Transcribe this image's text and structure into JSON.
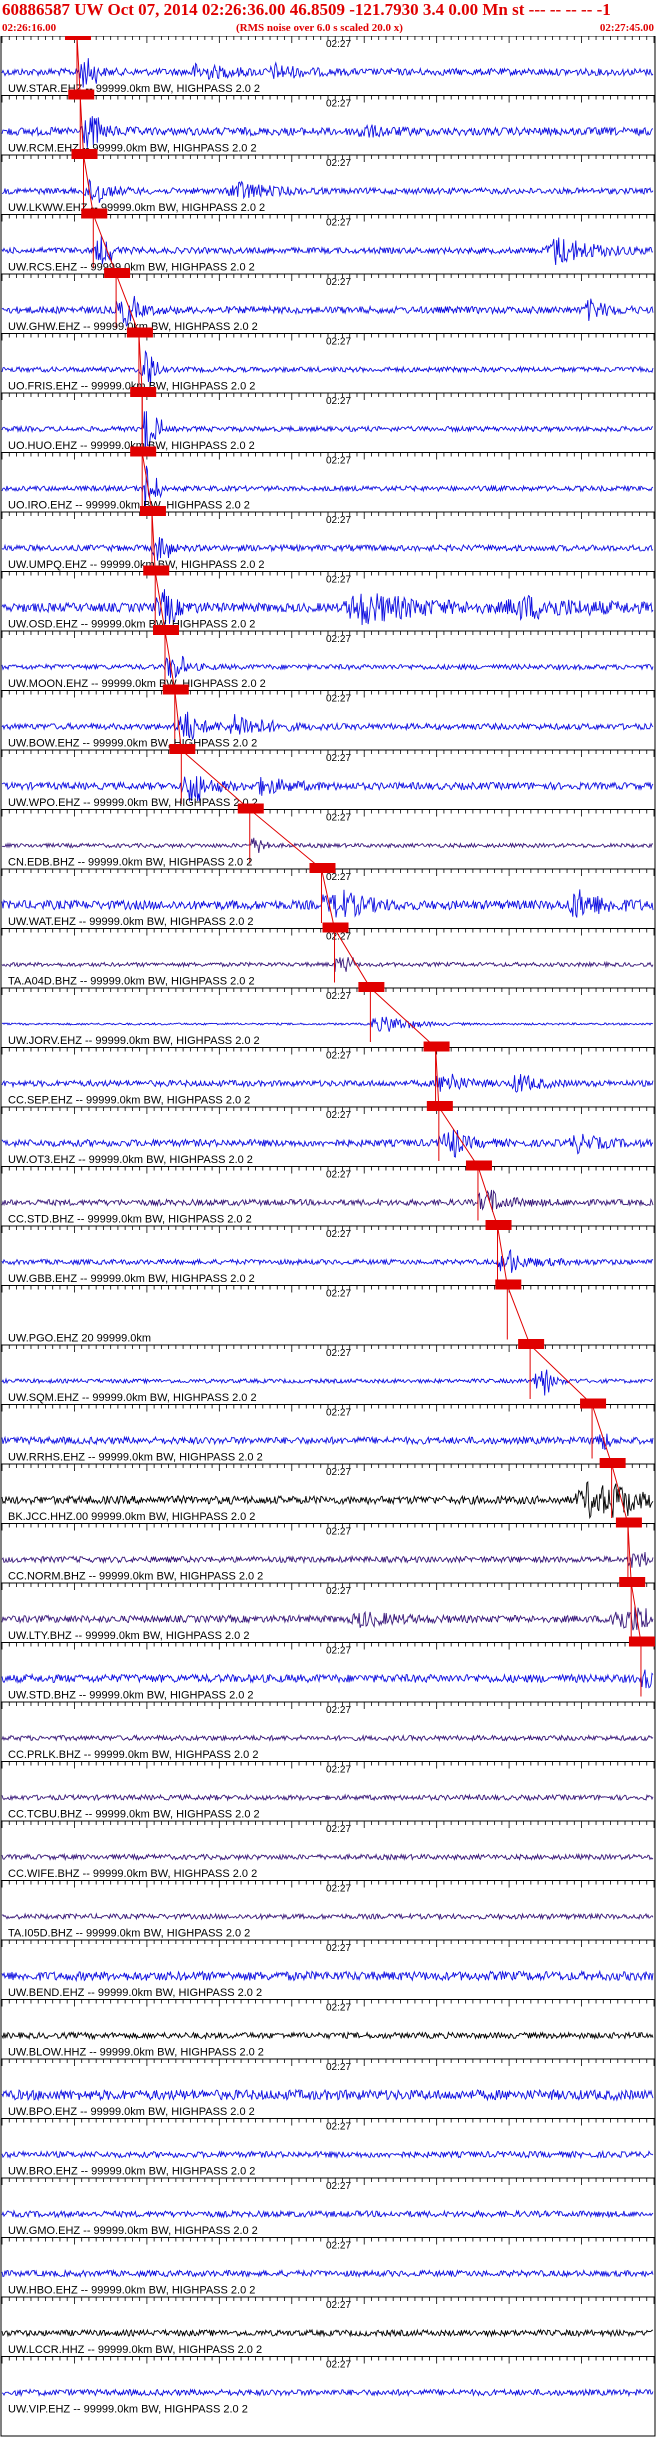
{
  "header": {
    "title": "60886587 UW Oct 07, 2014 02:26:36.00   46.8509 -121.7930  3.4 0.00 Mn st --- -- -- -- -1",
    "start_time": "02:26:16.00",
    "note": "(RMS noise over 6.0 s scaled 20.0 x)",
    "end_time": "02:27:45.00"
  },
  "axis": {
    "mid_tick_label": "02:27"
  },
  "colors": {
    "pick": "#e00000",
    "blue": "#1010e0",
    "purple": "#3a1a7a",
    "black": "#000000"
  },
  "traces": [
    {
      "label": "UW.STAR.EHZ -- 99999.0km BW, HIGHPASS  2.0  2",
      "color": "#1010e0",
      "amp": 0.35,
      "pick": 0.115,
      "bursts": [
        {
          "at": 0.12,
          "w": 0.02,
          "a": 1.0
        },
        {
          "at": 0.3,
          "w": 0.05,
          "a": 0.7
        },
        {
          "at": 0.42,
          "w": 0.04,
          "a": 0.6
        }
      ]
    },
    {
      "label": "UW.RCM.EHZ -- 99999.0km BW, HIGHPASS  2.0  2",
      "color": "#1010e0",
      "amp": 0.4,
      "pick": 0.12,
      "bursts": [
        {
          "at": 0.13,
          "w": 0.03,
          "a": 0.9
        },
        {
          "at": 0.55,
          "w": 0.04,
          "a": 0.5
        }
      ]
    },
    {
      "label": "UW.LKWW.EHZ -- 99999.0km BW, HIGHPASS  2.0  2",
      "color": "#1010e0",
      "amp": 0.3,
      "pick": 0.125,
      "bursts": [
        {
          "at": 0.14,
          "w": 0.03,
          "a": 0.8
        },
        {
          "at": 0.36,
          "w": 0.05,
          "a": 0.9
        }
      ]
    },
    {
      "label": "UW.RCS.EHZ -- 99999.0km BW, HIGHPASS  2.0  2",
      "color": "#1010e0",
      "amp": 0.3,
      "pick": 0.14,
      "bursts": [
        {
          "at": 0.15,
          "w": 0.02,
          "a": 0.7
        },
        {
          "at": 0.85,
          "w": 0.06,
          "a": 1.4
        }
      ]
    },
    {
      "label": "UW.GHW.EHZ -- 99999.0km BW, HIGHPASS  2.0  2",
      "color": "#1010e0",
      "amp": 0.35,
      "pick": 0.175,
      "bursts": [
        {
          "at": 0.19,
          "w": 0.03,
          "a": 0.8
        },
        {
          "at": 0.9,
          "w": 0.03,
          "a": 0.9
        }
      ]
    },
    {
      "label": "UO.FRIS.EHZ -- 99999.0km BW, HIGHPASS  2.0  2",
      "color": "#1010e0",
      "amp": 0.25,
      "pick": 0.21,
      "bursts": [
        {
          "at": 0.22,
          "w": 0.01,
          "a": 2.5
        }
      ]
    },
    {
      "label": "UO.HUO.EHZ -- 99999.0km BW, HIGHPASS  2.0  2",
      "color": "#1010e0",
      "amp": 0.25,
      "pick": 0.215,
      "bursts": [
        {
          "at": 0.22,
          "w": 0.01,
          "a": 2.5
        }
      ]
    },
    {
      "label": "UO.IRO.EHZ -- 99999.0km BW, HIGHPASS  2.0  2",
      "color": "#1010e0",
      "amp": 0.25,
      "pick": 0.215,
      "bursts": [
        {
          "at": 0.22,
          "w": 0.01,
          "a": 2.5
        }
      ]
    },
    {
      "label": "UW.UMPQ.EHZ -- 99999.0km BW, HIGHPASS  2.0  2",
      "color": "#1010e0",
      "amp": 0.3,
      "pick": 0.23,
      "bursts": [
        {
          "at": 0.24,
          "w": 0.02,
          "a": 0.6
        }
      ]
    },
    {
      "label": "UW.OSD.EHZ -- 99999.0km BW, HIGHPASS  2.0  2",
      "color": "#1010e0",
      "amp": 0.45,
      "pick": 0.235,
      "bursts": [
        {
          "at": 0.25,
          "w": 0.03,
          "a": 0.9
        },
        {
          "at": 0.55,
          "w": 0.1,
          "a": 1.5
        },
        {
          "at": 0.8,
          "w": 0.12,
          "a": 0.9
        }
      ]
    },
    {
      "label": "UW.MOON.EHZ -- 99999.0km BW, HIGHPASS  2.0  2",
      "color": "#1010e0",
      "amp": 0.25,
      "pick": 0.25,
      "bursts": [
        {
          "at": 0.26,
          "w": 0.03,
          "a": 0.6
        }
      ]
    },
    {
      "label": "UW.BOW.EHZ -- 99999.0km BW, HIGHPASS  2.0  2",
      "color": "#1010e0",
      "amp": 0.3,
      "pick": 0.265,
      "bursts": [
        {
          "at": 0.28,
          "w": 0.04,
          "a": 0.9
        },
        {
          "at": 0.36,
          "w": 0.05,
          "a": 1.1
        }
      ]
    },
    {
      "label": "UW.WPO.EHZ -- 99999.0km BW, HIGHPASS  2.0  2",
      "color": "#1010e0",
      "amp": 0.35,
      "pick": 0.275,
      "bursts": [
        {
          "at": 0.29,
          "w": 0.04,
          "a": 1.0
        },
        {
          "at": 0.4,
          "w": 0.05,
          "a": 0.7
        }
      ]
    },
    {
      "label": "CN.EDB.BHZ -- 99999.0km BW, HIGHPASS  2.0  2",
      "color": "#3a1a7a",
      "amp": 0.2,
      "pick": 0.38,
      "bursts": []
    },
    {
      "label": "UW.WAT.EHZ -- 99999.0km BW, HIGHPASS  2.0  2",
      "color": "#1010e0",
      "amp": 0.45,
      "pick": 0.49,
      "bursts": [
        {
          "at": 0.52,
          "w": 0.04,
          "a": 1.3
        },
        {
          "at": 0.88,
          "w": 0.05,
          "a": 1.3
        }
      ]
    },
    {
      "label": "TA.A04D.BHZ -- 99999.0km BW, HIGHPASS  2.0  2",
      "color": "#3a1a7a",
      "amp": 0.2,
      "pick": 0.51,
      "bursts": []
    },
    {
      "label": "UW.JORV.EHZ -- 99999.0km BW, HIGHPASS  2.0  2",
      "color": "#1010e0",
      "amp": 0.1,
      "pick": 0.565,
      "bursts": [
        {
          "at": 0.6,
          "w": 0.04,
          "a": 0.7
        }
      ]
    },
    {
      "label": "CC.SEP.EHZ -- 99999.0km BW, HIGHPASS  2.0  2",
      "color": "#1010e0",
      "amp": 0.3,
      "pick": 0.665,
      "bursts": [
        {
          "at": 0.69,
          "w": 0.03,
          "a": 0.6
        },
        {
          "at": 0.79,
          "w": 0.03,
          "a": 1.0
        }
      ]
    },
    {
      "label": "UW.OT3.EHZ -- 99999.0km BW, HIGHPASS  2.0  2",
      "color": "#1010e0",
      "amp": 0.35,
      "pick": 0.67,
      "bursts": [
        {
          "at": 0.69,
          "w": 0.03,
          "a": 0.9
        },
        {
          "at": 0.88,
          "w": 0.04,
          "a": 0.8
        }
      ]
    },
    {
      "label": "CC.STD.BHZ -- 99999.0km BW, HIGHPASS  2.0  2",
      "color": "#3a1a7a",
      "amp": 0.3,
      "pick": 0.73,
      "bursts": [
        {
          "at": 0.75,
          "w": 0.05,
          "a": 0.5
        }
      ]
    },
    {
      "label": "UW.GBB.EHZ -- 99999.0km BW, HIGHPASS  2.0  2",
      "color": "#1010e0",
      "amp": 0.25,
      "pick": 0.76,
      "bursts": [
        {
          "at": 0.78,
          "w": 0.06,
          "a": 0.5
        }
      ]
    },
    {
      "label": "UW.PGO.EHZ 20 99999.0km",
      "color": "#1010e0",
      "amp": 0.0,
      "pick": 0.775,
      "bursts": []
    },
    {
      "label": "UW.SQM.EHZ -- 99999.0km BW, HIGHPASS  2.0  2",
      "color": "#1010e0",
      "amp": 0.2,
      "pick": 0.81,
      "bursts": [
        {
          "at": 0.83,
          "w": 0.02,
          "a": 0.8
        }
      ]
    },
    {
      "label": "UW.RRHS.EHZ -- 99999.0km BW, HIGHPASS  2.0  2",
      "color": "#1010e0",
      "amp": 0.35,
      "pick": 0.905,
      "bursts": []
    },
    {
      "label": "BK.JCC.HHZ.00 99999.0km BW, HIGHPASS  2.0  2",
      "color": "#000000",
      "amp": 0.4,
      "pick": 0.935,
      "bursts": [
        {
          "at": 0.9,
          "w": 0.08,
          "a": 1.6
        }
      ]
    },
    {
      "label": "CC.NORM.BHZ -- 99999.0km BW, HIGHPASS  2.0  2",
      "color": "#3a1a7a",
      "amp": 0.3,
      "pick": 0.96,
      "bursts": []
    },
    {
      "label": "UW.LTY.BHZ -- 99999.0km BW, HIGHPASS  2.0  2",
      "color": "#3a1a7a",
      "amp": 0.35,
      "pick": 0.965,
      "bursts": [
        {
          "at": 0.94,
          "w": 0.05,
          "a": 1.1
        },
        {
          "at": 0.55,
          "w": 0.06,
          "a": 0.6
        }
      ]
    },
    {
      "label": "UW.STD.BHZ -- 99999.0km BW, HIGHPASS  2.0  2",
      "color": "#1010e0",
      "amp": 0.4,
      "pick": 0.98,
      "bursts": []
    },
    {
      "label": "CC.PRLK.BHZ -- 99999.0km BW, HIGHPASS  2.0  2",
      "color": "#3a1a7a",
      "amp": 0.25,
      "pick": null,
      "bursts": []
    },
    {
      "label": "CC.TCBU.BHZ -- 99999.0km BW, HIGHPASS  2.0  2",
      "color": "#3a1a7a",
      "amp": 0.25,
      "pick": null,
      "bursts": []
    },
    {
      "label": "CC.WIFE.BHZ -- 99999.0km BW, HIGHPASS  2.0  2",
      "color": "#3a1a7a",
      "amp": 0.25,
      "pick": null,
      "bursts": []
    },
    {
      "label": "TA.I05D.BHZ -- 99999.0km BW, HIGHPASS  2.0  2",
      "color": "#3a1a7a",
      "amp": 0.25,
      "pick": null,
      "bursts": []
    },
    {
      "label": "UW.BEND.EHZ -- 99999.0km BW, HIGHPASS  2.0  2",
      "color": "#1010e0",
      "amp": 0.45,
      "pick": null,
      "bursts": []
    },
    {
      "label": "UW.BLOW.HHZ -- 99999.0km BW, HIGHPASS  2.0  2",
      "color": "#000000",
      "amp": 0.3,
      "pick": null,
      "bursts": []
    },
    {
      "label": "UW.BPO.EHZ -- 99999.0km BW, HIGHPASS  2.0  2",
      "color": "#1010e0",
      "amp": 0.5,
      "pick": null,
      "bursts": []
    },
    {
      "label": "UW.BRO.EHZ -- 99999.0km BW, HIGHPASS  2.0  2",
      "color": "#1010e0",
      "amp": 0.3,
      "pick": null,
      "bursts": []
    },
    {
      "label": "UW.GMO.EHZ -- 99999.0km BW, HIGHPASS  2.0  2",
      "color": "#1010e0",
      "amp": 0.3,
      "pick": null,
      "bursts": []
    },
    {
      "label": "UW.HBO.EHZ -- 99999.0km BW, HIGHPASS  2.0  2",
      "color": "#1010e0",
      "amp": 0.3,
      "pick": null,
      "bursts": []
    },
    {
      "label": "UW.LCCR.HHZ -- 99999.0km BW, HIGHPASS  2.0  2",
      "color": "#000000",
      "amp": 0.3,
      "pick": null,
      "bursts": []
    },
    {
      "label": "UW.VIP.EHZ -- 99999.0km BW, HIGHPASS  2.0  2",
      "color": "#1010e0",
      "amp": 0.3,
      "pick": null,
      "bursts": []
    }
  ]
}
